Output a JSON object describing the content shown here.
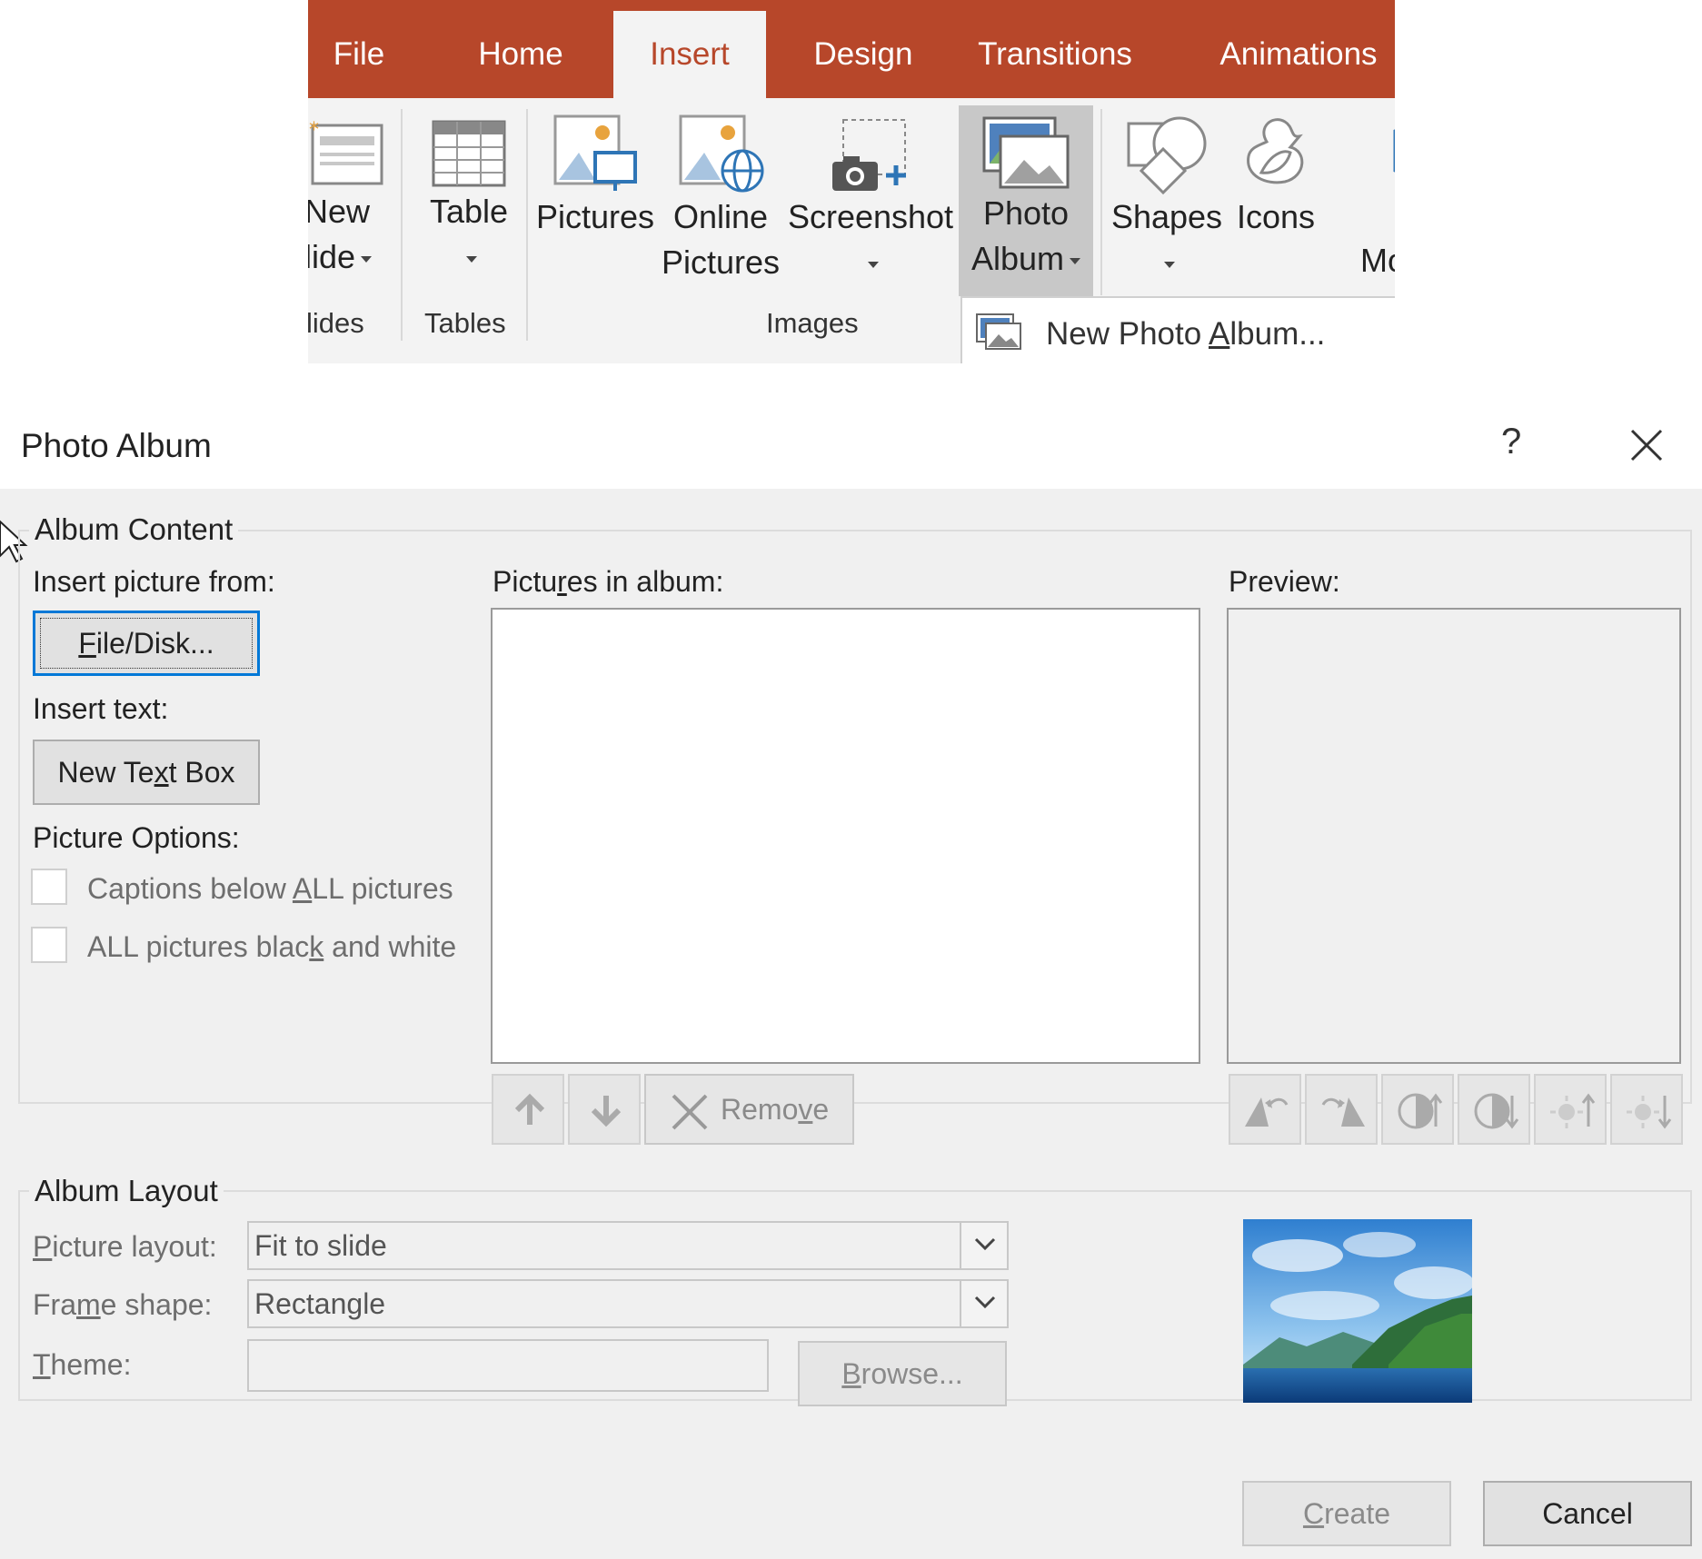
{
  "ribbon": {
    "tabs": [
      "File",
      "Home",
      "Insert",
      "Design",
      "Transitions",
      "Animations"
    ],
    "active_tab": "Insert",
    "accent_color": "#b7472a",
    "buttons": {
      "new_slide_line1": "New",
      "new_slide_line2": "lide",
      "table": "Table",
      "pictures": "Pictures",
      "online_pictures_line1": "Online",
      "online_pictures_line2": "Pictures",
      "screenshot": "Screenshot",
      "photo_album_line1": "Photo",
      "photo_album_line2": "Album",
      "shapes": "Shapes",
      "icons": "Icons",
      "more_partial": "Mo"
    },
    "groups": {
      "slides": "lides",
      "tables": "Tables",
      "images": "Images"
    },
    "dropdown": {
      "new_photo_album_pre": "New Photo ",
      "new_photo_album_key": "A",
      "new_photo_album_post": "lbum..."
    }
  },
  "dialog": {
    "title": "Photo Album",
    "help": "?",
    "album_content": {
      "legend": "Album Content",
      "insert_picture_from": "Insert picture from:",
      "file_disk_key": "F",
      "file_disk_rest": "ile/Disk...",
      "insert_text": "Insert text:",
      "new_text_box_pre": "New Te",
      "new_text_box_key": "x",
      "new_text_box_post": "t Box",
      "picture_options": "Picture Options:",
      "captions_pre": "Captions below ",
      "captions_key": "A",
      "captions_post": "LL pictures",
      "bw_pre": "ALL pictures blac",
      "bw_key": "k",
      "bw_post": " and white",
      "pictures_in_album_pre": "Pictu",
      "pictures_in_album_key": "r",
      "pictures_in_album_post": "es in album:",
      "remove_pre": "Remo",
      "remove_key": "v",
      "remove_post": "e",
      "preview": "Preview:"
    },
    "album_layout": {
      "legend": "Album Layout",
      "picture_layout_key": "P",
      "picture_layout_rest": "icture layout:",
      "picture_layout_value": "Fit to slide",
      "frame_shape_pre": "Fra",
      "frame_shape_key": "m",
      "frame_shape_post": "e shape:",
      "frame_shape_value": "Rectangle",
      "theme_key": "T",
      "theme_rest": "heme:",
      "theme_value": "",
      "browse_key": "B",
      "browse_rest": "rowse..."
    },
    "create_key": "C",
    "create_rest": "reate",
    "cancel": "Cancel"
  }
}
